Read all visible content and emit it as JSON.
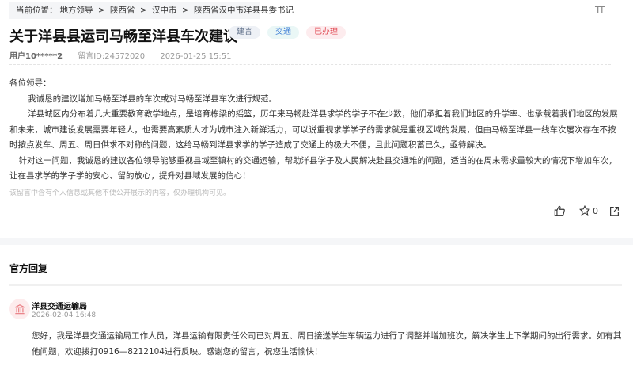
{
  "breadcrumb": {
    "label": "当前位置：",
    "items": [
      "地方领导",
      "陕西省",
      "汉中市",
      "陕西省汉中市洋县县委书记"
    ],
    "sep": ">"
  },
  "font_size_toggle": "TT",
  "title": "关于洋县县运司马畅至洋县车次建议",
  "tags": [
    {
      "label": "建言",
      "bg": "#eef1f6",
      "color": "#5a6b85"
    },
    {
      "label": "交通",
      "bg": "#eaf7f6",
      "color": "#3a7bd5"
    },
    {
      "label": "已办理",
      "bg": "#fdecee",
      "color": "#e0454f"
    }
  ],
  "meta": {
    "user": "用户10*****2",
    "id": "留言ID:24572020",
    "time": "2026-01-25 15:51"
  },
  "message": {
    "greeting": "各位领导：",
    "paragraphs": [
      "我诚恳的建议增加马畅至洋县的车次或对马畅至洋县车次进行规范。",
      "洋县城区内分布着几大重要教育教学地点，是培育栋梁的摇篮，历年来马畅赴洋县求学的学子不在少数，他们承担着我们地区的升学率、也承载着我们地区的发展和未来，城市建设发展需要年轻人，也需要高素质人才为城市注入新鲜活力，可以说重视求学学子的需求就是重视区域的发展，但由马畅至洋县一线车次屡次存在不按时按点发车、周五、周日供求不对称的问题，这给马畅到洋县求学的学子造成了交通上的极大不便，且此问题积蓄已久，亟待解决。",
      "针对这一问题，我诚恳的建议各位领导能够重视县域至镇村的交通运输，帮助洋县学子及人民解决赴县交通难的问题，适当的在周末需求量较大的情况下增加车次，让在县求学的学子学的安心、留的放心，提升对县域发展的信心！"
    ],
    "privacy_note": "该留言中含有个人信息或其他不便公开展示的内容，仅办理机构可见。"
  },
  "actions": {
    "favorite_count": "0"
  },
  "reply": {
    "section_title": "官方回复",
    "org": "洋县交通运输局",
    "time": "2026-02-04 16:48",
    "text": "您好，我是洋县交通运输局工作人员，洋县运输有限责任公司已对周五、周日接送学生车辆运力进行了调整并增加班次，解决学生上下学期间的出行需求。如有其他问题，欢迎拨打0916—8212104进行反映。感谢您的留言，祝您生活愉快！"
  }
}
